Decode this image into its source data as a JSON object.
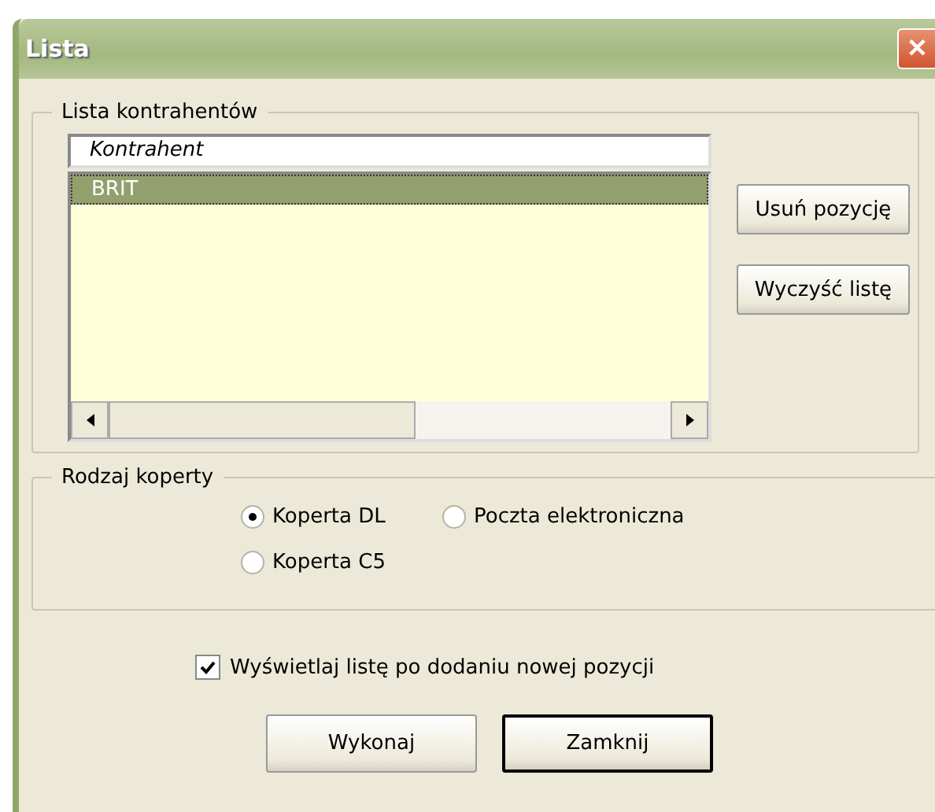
{
  "window": {
    "title": "Lista",
    "close": "✕"
  },
  "contractors": {
    "legend": "Lista kontrahentów",
    "header": "Kontrahent",
    "items": [
      {
        "name": "BRIT",
        "selected": true
      }
    ],
    "buttons": [
      "Usuń pozycję",
      "Wyczyść listę"
    ]
  },
  "envelope": {
    "legend": "Rodzaj koperty",
    "options": [
      {
        "label": "Koperta DL",
        "selected": true
      },
      {
        "label": "Poczta elektroniczna",
        "selected": false
      },
      {
        "label": "Koperta C5",
        "selected": false
      }
    ]
  },
  "show_list": {
    "label": "Wyświetlaj listę po dodaniu nowej pozycji",
    "checked": true
  },
  "buttons": [
    {
      "label": "Wykonaj",
      "default": false
    },
    {
      "label": "Zamknij",
      "default": true
    }
  ]
}
